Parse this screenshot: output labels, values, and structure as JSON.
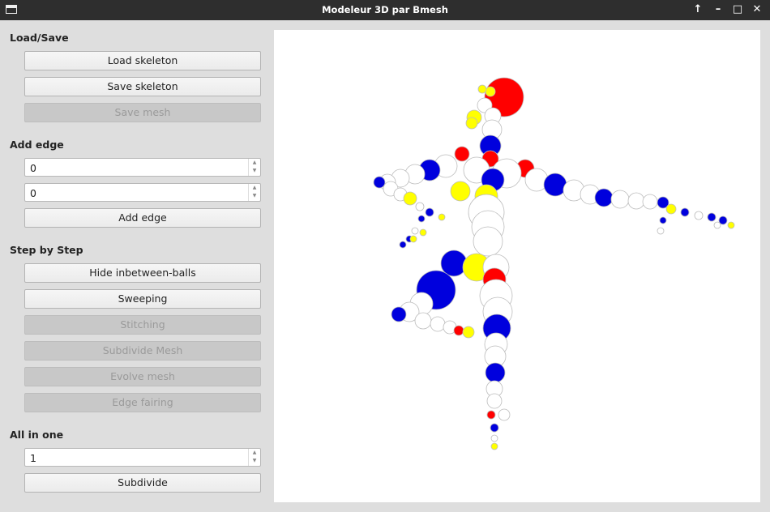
{
  "window": {
    "title": "Modeleur 3D par Bmesh",
    "controls": [
      "arrow-up-icon",
      "minimize-icon",
      "maximize-icon",
      "close-icon"
    ]
  },
  "load_save": {
    "heading": "Load/Save",
    "load_skeleton": "Load skeleton",
    "save_skeleton": "Save skeleton",
    "save_mesh": "Save mesh"
  },
  "add_edge": {
    "heading": "Add edge",
    "from_value": "0",
    "to_value": "0",
    "button": "Add edge"
  },
  "step_by_step": {
    "heading": "Step by Step",
    "hide_balls": "Hide inbetween-balls",
    "sweeping": "Sweeping",
    "stitching": "Stitching",
    "subdivide_mesh": "Subdivide Mesh",
    "evolve_mesh": "Evolve mesh",
    "edge_fairing": "Edge fairing"
  },
  "all_in_one": {
    "heading": "All in one",
    "level_value": "1",
    "button": "Subdivide"
  },
  "viewport": {
    "content": "3D skeleton made of spheres",
    "colors": {
      "red": "#ff0000",
      "blue": "#0000e0",
      "yellow": "#f2ef00",
      "white": "#ffffff"
    }
  }
}
